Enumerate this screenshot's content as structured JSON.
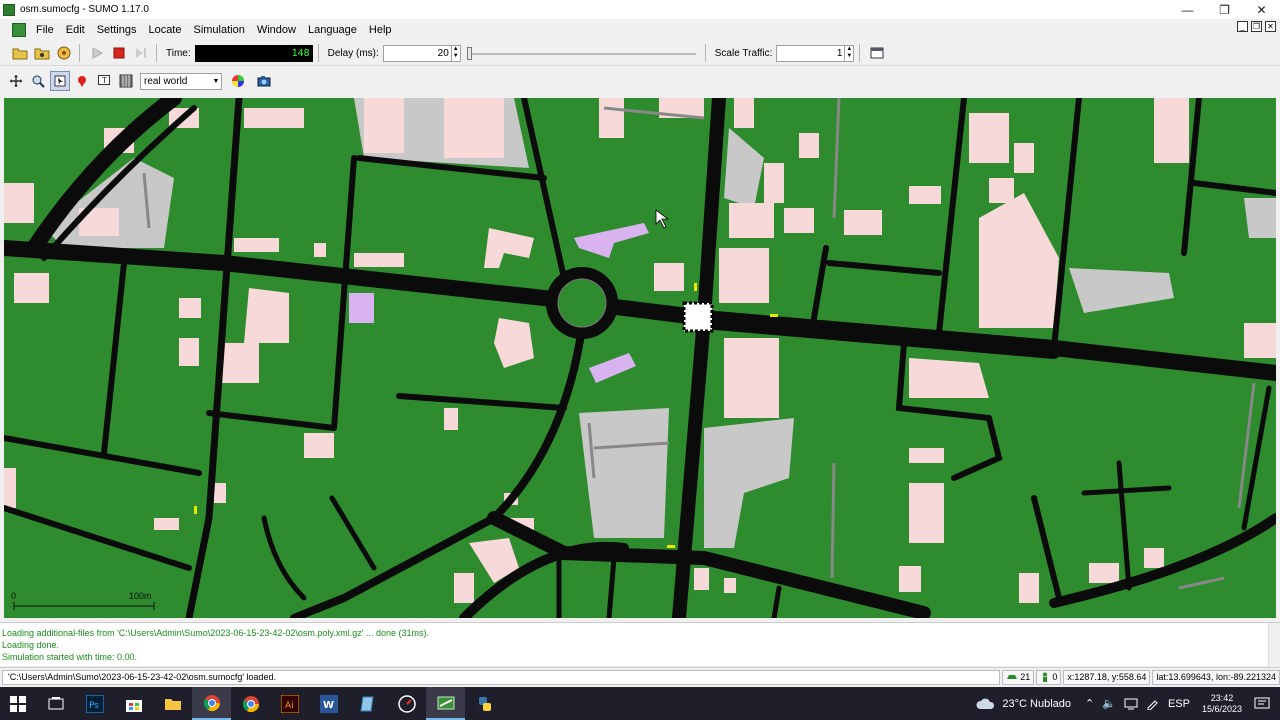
{
  "window": {
    "title": "osm.sumocfg - SUMO 1.17.0"
  },
  "menu": [
    "File",
    "Edit",
    "Settings",
    "Locate",
    "Simulation",
    "Window",
    "Language",
    "Help"
  ],
  "toolbar": {
    "time_label": "Time:",
    "time_value": "148",
    "delay_label": "Delay (ms):",
    "delay_value": "20",
    "scale_label": "Scale Traffic:",
    "scale_value": "1"
  },
  "viewbar": {
    "scheme": "real world"
  },
  "map": {
    "scale_start": "0",
    "scale_end": "100m"
  },
  "log": [
    "Loading additional-files from 'C:\\Users\\Admin\\Sumo\\2023-06-15-23-42-02\\osm.poly.xml.gz' ... done (31ms).",
    "Loading done.",
    "Simulation started with time: 0.00."
  ],
  "status": {
    "message": "'C:\\Users\\Admin\\Sumo\\2023-06-15-23-42-02\\osm.sumocfg' loaded.",
    "vehicles": "21",
    "persons": "0",
    "coords": "x:1287.18, y:558.64",
    "latlon": "lat:13.699643, lon:-89.221324"
  },
  "taskbar": {
    "weather": "23°C  Nublado",
    "lang": "ESP",
    "time": "23:42",
    "date": "15/6/2023"
  },
  "colors": {
    "grass": "#2e8b2e",
    "road": "#111111",
    "building": "#f7d9d9",
    "parking": "#c8c8c8",
    "poi": "#d9b3f0"
  }
}
